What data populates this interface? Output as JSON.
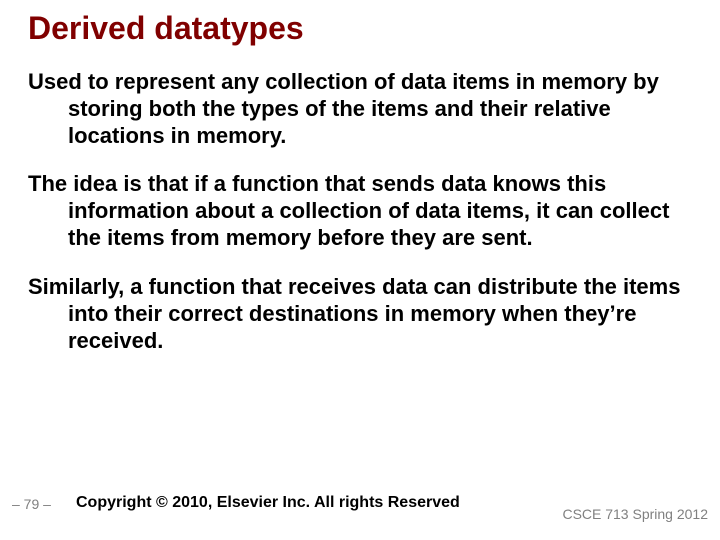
{
  "title": "Derived datatypes",
  "paragraphs": [
    "Used to represent any collection of data items in memory by storing both the types of the items and their relative locations in memory.",
    "The idea is that if a function that sends data knows this information about a collection of data items, it can collect the items from memory before they are sent.",
    "Similarly, a function that receives data can distribute the items into their correct destinations in memory when they’re received."
  ],
  "footer": {
    "page_number": "– 79 –",
    "copyright": "Copyright © 2010, Elsevier Inc. All rights Reserved",
    "course": "CSCE 713 Spring 2012"
  }
}
